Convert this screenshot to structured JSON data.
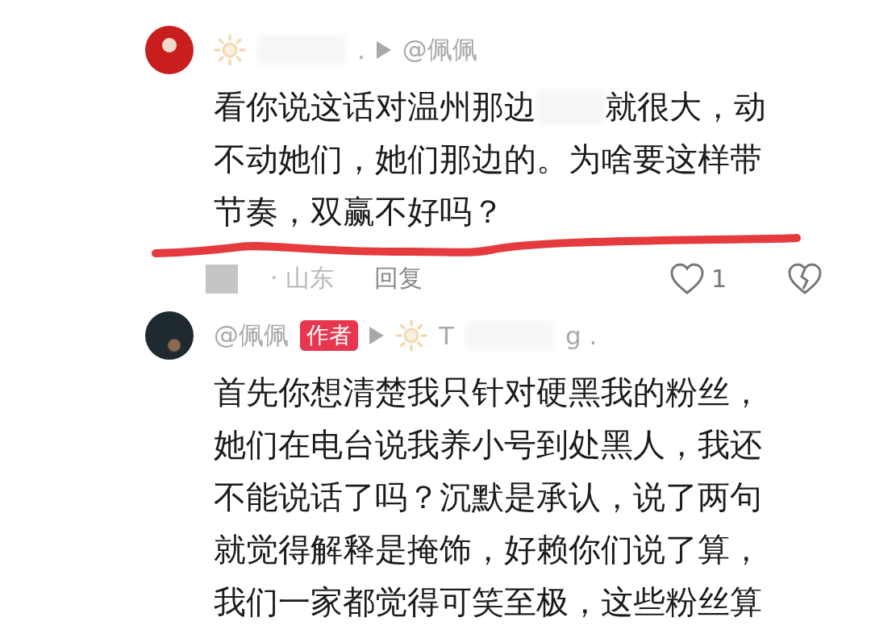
{
  "comments": [
    {
      "avatar": {
        "kind": "red"
      },
      "header": [
        {
          "kind": "sun"
        },
        {
          "kind": "redacted"
        },
        {
          "kind": "text",
          "text": "."
        },
        {
          "kind": "arrow"
        },
        {
          "kind": "text",
          "text": "@佩佩"
        }
      ],
      "lines": [
        [
          {
            "kind": "text",
            "text": "看你说这话对温州那边"
          },
          {
            "kind": "redacted"
          },
          {
            "kind": "text",
            "text": "就很大，动"
          }
        ],
        [
          {
            "kind": "text",
            "text": "不动她们，她们那边的。为啥要这样带"
          }
        ],
        [
          {
            "kind": "text",
            "text": "节奏，双赢不好吗？"
          }
        ]
      ],
      "meta": {
        "location": "· 山东",
        "reply": "回复",
        "likes": "1"
      },
      "annotation": {
        "kind": "red-stroke"
      }
    },
    {
      "avatar": {
        "kind": "dark"
      },
      "header": [
        {
          "kind": "text",
          "text": "@佩佩"
        },
        {
          "kind": "badge",
          "text": "作者"
        },
        {
          "kind": "arrow"
        },
        {
          "kind": "sun"
        },
        {
          "kind": "text",
          "text": "T"
        },
        {
          "kind": "redacted"
        },
        {
          "kind": "text",
          "text": "g ."
        }
      ],
      "lines": [
        [
          {
            "kind": "text",
            "text": "首先你想清楚我只针对硬黑我的粉丝，"
          }
        ],
        [
          {
            "kind": "text",
            "text": "她们在电台说我养小号到处黑人，我还"
          }
        ],
        [
          {
            "kind": "text",
            "text": "不能说话了吗？沉默是承认，说了两句"
          }
        ],
        [
          {
            "kind": "text",
            "text": "就觉得解释是掩饰，好赖你们说了算，"
          }
        ],
        [
          {
            "kind": "text",
            "text": "我们一家都觉得可笑至极，这些粉丝算"
          }
        ]
      ]
    }
  ]
}
